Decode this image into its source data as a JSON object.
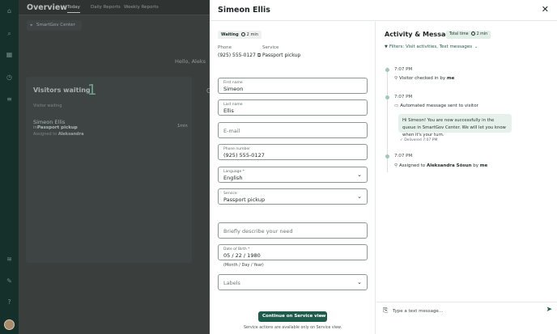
{
  "background": {
    "title": "Overview",
    "tabs": [
      "Today",
      "Daily Reports",
      "Weekly Reports"
    ],
    "location": "SmartGov Center",
    "greeting": "Hello, Aleks",
    "visitors_waiting_label": "Visitors waiting",
    "visitors_waiting_count": "1",
    "column_label": "Visitor waiting",
    "visitor_name": "Simeon Ellis",
    "visitor_service_prefix": "in",
    "visitor_service": "Passport pickup",
    "visitor_assigned_prefix": "Assigned to",
    "visitor_assigned": "Aleksandra",
    "visitor_time": "1min",
    "edge_text": "C"
  },
  "drawer": {
    "title": "Simeon Ellis",
    "status_label": "Waiting",
    "status_time": "2 min",
    "phone_label": "Phone",
    "phone_value": "(925) 555-0127",
    "service_label": "Service",
    "service_value": "Passport pickup",
    "form": {
      "first_name_label": "First name",
      "first_name": "Simeon",
      "last_name_label": "Last name",
      "last_name": "Ellis",
      "email_placeholder": "E-mail",
      "phone_label": "Phone number",
      "phone": "(925) 555-0127",
      "language_label": "Language *",
      "language": "English",
      "service_label": "Service",
      "service": "Passport pickup",
      "need_placeholder": "Briefly describe your need",
      "dob_label": "Date of Birth *",
      "dob": "05 / 22 / 1980",
      "dob_hint": "(Month / Day / Year)",
      "labels_placeholder": "Labels"
    },
    "cta_label": "Continue on Service view",
    "cta_note": "Service actions are available only on Service view."
  },
  "activity": {
    "title": "Activity & Messages",
    "total_time_label": "Total time",
    "total_time": "2 min",
    "filters": "Filters: Visit activities, Text messages",
    "events": [
      {
        "time": "7:07 PM",
        "text": "Visitor checked in by",
        "bold": "me"
      },
      {
        "time": "7:07 PM",
        "text": "Automated message sent to visitor"
      },
      {
        "time": "7:07 PM",
        "text": "Assigned to",
        "bold": "Aleksandra Sõsun",
        "text2": "by",
        "bold2": "me"
      }
    ],
    "message": "Hi Simeon! You are now successfully in the queue in SmartGov Center. We will let you know when it's your turn.",
    "delivered": "Delivered 7:07 PM",
    "composer_placeholder": "Type a text message..."
  },
  "colors": {
    "brand": "#1d5b4c",
    "rail": "#15302a",
    "bubble": "#e6f1ec"
  }
}
